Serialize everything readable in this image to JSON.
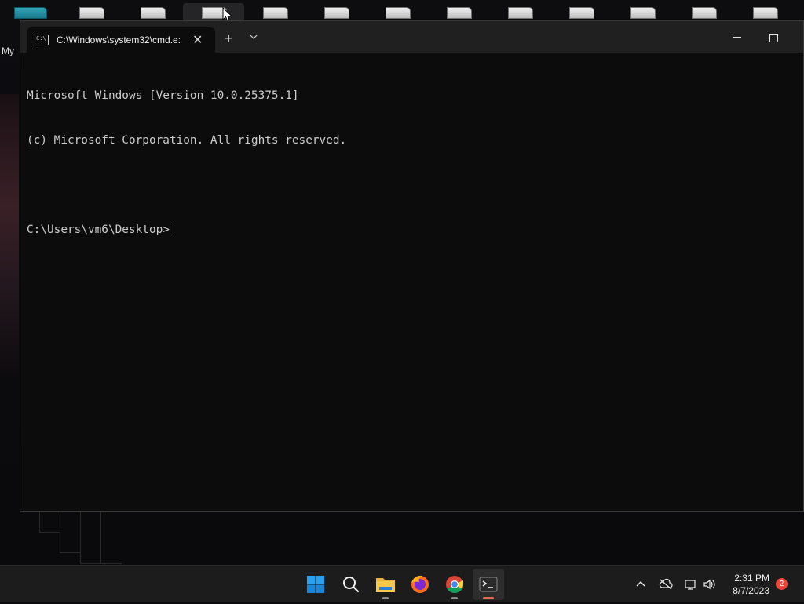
{
  "desktop": {
    "partial_label": "My"
  },
  "window": {
    "tab_title": "C:\\Windows\\system32\\cmd.e:",
    "tab_close_symbol": "✕",
    "new_tab_symbol": "+"
  },
  "console": {
    "lines": [
      "Microsoft Windows [Version 10.0.25375.1]",
      "(c) Microsoft Corporation. All rights reserved.",
      "",
      "C:\\Users\\vm6\\Desktop>"
    ]
  },
  "taskbar": {
    "apps": [
      "start-icon",
      "search-icon",
      "file-explorer-icon",
      "firefox-icon",
      "chrome-icon",
      "terminal-icon"
    ],
    "active_app": "terminal-icon",
    "clock": {
      "time": "2:31 PM",
      "date": "8/7/2023"
    },
    "notification_count": "2"
  },
  "colors": {
    "terminal_bg": "#0c0c0c",
    "titlebar_bg": "#202020",
    "taskbar_bg": "#1c1c1c",
    "accent_indicator": "#e06b54",
    "badge": "#e8473a"
  }
}
